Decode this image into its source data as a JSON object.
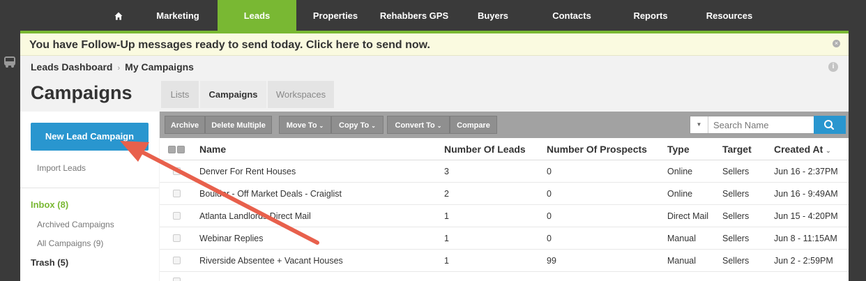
{
  "nav": {
    "home_icon": "home-icon",
    "items": [
      {
        "label": "Marketing"
      },
      {
        "label": "Leads"
      },
      {
        "label": "Properties"
      },
      {
        "label": "Rehabbers GPS"
      },
      {
        "label": "Buyers"
      },
      {
        "label": "Contacts"
      },
      {
        "label": "Reports"
      },
      {
        "label": "Resources"
      }
    ],
    "active": "Leads"
  },
  "alert": {
    "text": "You have Follow-Up messages ready to send today. Click here to send now.",
    "close_glyph": "×"
  },
  "breadcrumb": {
    "items": [
      "Leads Dashboard",
      "My Campaigns"
    ],
    "separator": "›"
  },
  "info_glyph": "i",
  "page": {
    "title": "Campaigns",
    "tabs": [
      {
        "label": "Lists"
      },
      {
        "label": "Campaigns"
      },
      {
        "label": "Workspaces"
      }
    ],
    "active_tab": "Campaigns"
  },
  "sidebar": {
    "new_button": "New Lead Campaign",
    "import_link": "Import Leads",
    "inbox": "Inbox (8)",
    "archived": "Archived Campaigns",
    "all": "All Campaigns (9)",
    "trash": "Trash (5)"
  },
  "toolbar": {
    "archive": "Archive",
    "delete_multiple": "Delete Multiple",
    "move_to": "Move To",
    "copy_to": "Copy To",
    "convert_to": "Convert To",
    "compare": "Compare",
    "search_placeholder": "Search Name"
  },
  "table": {
    "headers": {
      "name": "Name",
      "leads": "Number Of Leads",
      "prospects": "Number Of Prospects",
      "type": "Type",
      "target": "Target",
      "created": "Created At"
    },
    "sort_column": "Created At",
    "sort_direction": "descending",
    "rows": [
      {
        "name": "Denver For Rent Houses",
        "leads": "3",
        "prospects": "0",
        "type": "Online",
        "target": "Sellers",
        "created": "Jun 16 - 2:37PM"
      },
      {
        "name": "Boulder - Off Market Deals - Craiglist",
        "leads": "2",
        "prospects": "0",
        "type": "Online",
        "target": "Sellers",
        "created": "Jun 16 - 9:49AM"
      },
      {
        "name": "Atlanta Landlords Direct Mail",
        "leads": "1",
        "prospects": "0",
        "type": "Direct Mail",
        "target": "Sellers",
        "created": "Jun 15 - 4:20PM"
      },
      {
        "name": "Webinar Replies",
        "leads": "1",
        "prospects": "0",
        "type": "Manual",
        "target": "Sellers",
        "created": "Jun 8 - 11:15AM"
      },
      {
        "name": "Riverside Absentee + Vacant Houses",
        "leads": "1",
        "prospects": "99",
        "type": "Manual",
        "target": "Sellers",
        "created": "Jun 2 - 2:59PM"
      }
    ]
  },
  "colors": {
    "nav_bg": "#3a3a3a",
    "accent_green": "#79b833",
    "primary_blue": "#2996cf",
    "alert_bg": "#fafae0",
    "annotation_arrow": "#e8604c"
  }
}
